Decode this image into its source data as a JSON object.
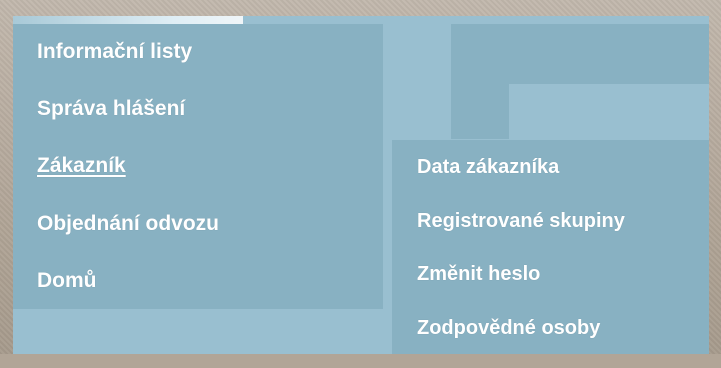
{
  "main_menu": {
    "items": [
      {
        "label": "Informační listy"
      },
      {
        "label": "Správa hlášení"
      },
      {
        "label": "Zákazník"
      },
      {
        "label": "Objednání odvozu"
      },
      {
        "label": "Domů"
      }
    ],
    "active_label": "Zákazník"
  },
  "submenu": {
    "items": [
      {
        "label": "Data zákazníka"
      },
      {
        "label": "Registrované skupiny"
      },
      {
        "label": "Změnit heslo"
      },
      {
        "label": "Zodpovědné osoby"
      }
    ]
  },
  "colors": {
    "frame": "#b3a79a",
    "panel": "#99bfd0",
    "menu_bg": "#88b1c2",
    "text": "#ffffff"
  }
}
